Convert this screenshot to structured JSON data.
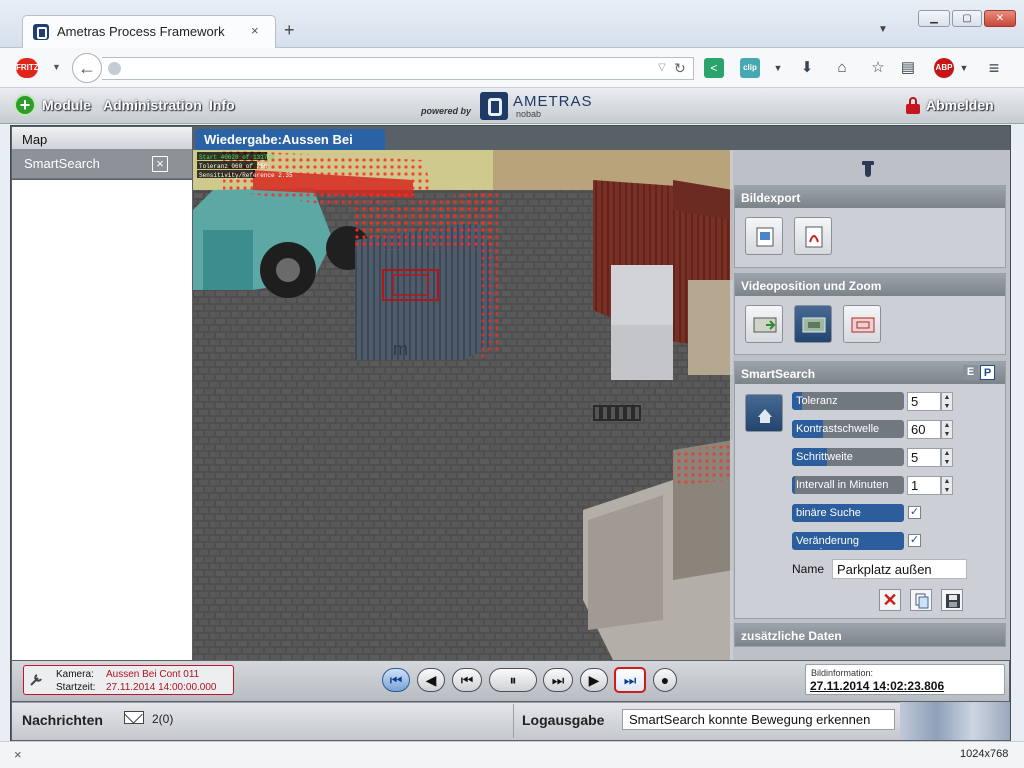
{
  "browser": {
    "tab_title": "Ametras Process Framework",
    "tab_close": "×",
    "new_tab": "+",
    "url": "",
    "status_left": "×",
    "status_right": "1024x768",
    "fritz_label": "FRITZ",
    "clip_label": "clip",
    "abp_label": "ABP"
  },
  "app": {
    "menu": {
      "module": "Module",
      "administration": "Administration",
      "info": "Info"
    },
    "powered_by": "powered by",
    "brand": "AMETRAS",
    "brand_sub": "nobab",
    "logout": "Abmelden",
    "left_panel_title": "Map",
    "left_tab_label": "SmartSearch",
    "left_tab_close": "×",
    "video_tab_label": "Wiedergabe:Aussen Bei",
    "overlay_lines": [
      "Start 40628 of 131729",
      "Toleranz 060 of 256",
      "Sensitivity/Reference 2.35"
    ],
    "camera_label": "Kamera:",
    "camera_value": "Aussen Bei Cont 011",
    "start_label": "Startzeit:",
    "start_value": "27.11.2014 14:00:00.000",
    "bild_label": "Bildinformation:",
    "bild_value": "27.11.2014 14:02:23.806"
  },
  "panel": {
    "bildexport": {
      "title": "Bildexport",
      "icons": [
        "export-image-icon",
        "export-pdf-icon"
      ]
    },
    "videoposition": {
      "title": "Videoposition und Zoom",
      "icons": [
        "position-left-icon",
        "position-active-icon",
        "zoom-frame-icon"
      ]
    },
    "smartsearch": {
      "title": "SmartSearch",
      "tag_e": "E",
      "tag_p": "P",
      "fields": [
        {
          "label": "Toleranz",
          "value": "5",
          "level": 0.09
        },
        {
          "label": "Kontrastschwelle",
          "value": "60",
          "level": 0.28
        },
        {
          "label": "Schrittweite",
          "value": "5",
          "level": 0.31
        },
        {
          "label": "Intervall in Minuten",
          "value": "1",
          "level": 0.03
        }
      ],
      "checks": [
        {
          "label": "binäre Suche",
          "checked": "✓"
        },
        {
          "label": "Veränderung anzeigen",
          "checked": "✓"
        }
      ],
      "name_label": "Name",
      "name_value": "Parkplatz außen"
    },
    "zusatz": {
      "title": "zusätzliche Daten"
    }
  },
  "controls": [
    {
      "name": "jump-start-button",
      "glyph": "⏮",
      "style": "blue"
    },
    {
      "name": "step-back-button",
      "glyph": "◀",
      "style": ""
    },
    {
      "name": "frame-back-button",
      "glyph": "⏮",
      "style": ""
    },
    {
      "name": "pause-button",
      "glyph": "⏸",
      "style": ""
    },
    {
      "name": "frame-forward-button",
      "glyph": "⏭",
      "style": ""
    },
    {
      "name": "step-forward-button",
      "glyph": "▶",
      "style": ""
    },
    {
      "name": "jump-end-button",
      "glyph": "⏭",
      "style": "red"
    },
    {
      "name": "record-button",
      "glyph": "●",
      "style": ""
    }
  ],
  "footer": {
    "nachrichten": "Nachrichten",
    "msg_count": "2(0)",
    "logausgabe": "Logausgabe",
    "log_text": "SmartSearch konnte Bewegung erkennen"
  },
  "colors": {
    "accent": "#2c5d9c",
    "tab_blue": "#2a62a6",
    "alert_red": "#c0152a",
    "detection_red": "#e8201c"
  }
}
